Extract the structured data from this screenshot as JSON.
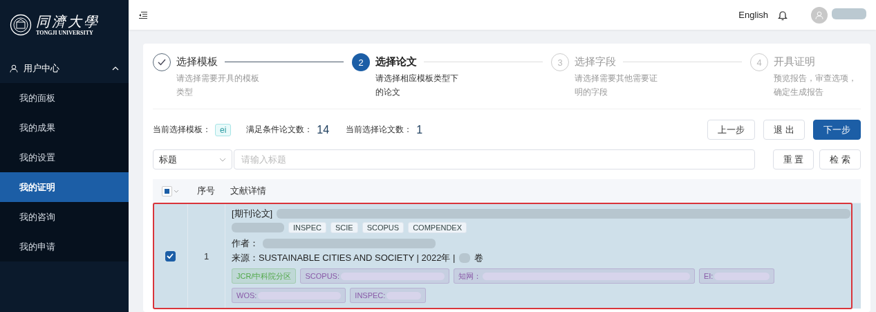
{
  "sidebar": {
    "logo": {
      "title": "同濟大學",
      "subtitle": "TONGJI UNIVERSITY"
    },
    "group": {
      "label": "用户中心",
      "expanded": true,
      "items": [
        {
          "label": "我的面板",
          "selected": false
        },
        {
          "label": "我的成果",
          "selected": false
        },
        {
          "label": "我的设置",
          "selected": false
        },
        {
          "label": "我的证明",
          "selected": true
        },
        {
          "label": "我的咨询",
          "selected": false
        },
        {
          "label": "我的申请",
          "selected": false
        }
      ]
    }
  },
  "header": {
    "language": "English"
  },
  "steps": [
    {
      "title": "选择模板",
      "description": "请选择需要开具的模板类型",
      "completed": true,
      "selected": false
    },
    {
      "number": "2",
      "title": "选择论文",
      "description": "请选择相应模板类型下的论文",
      "completed": false,
      "selected": true
    },
    {
      "number": "3",
      "title": "选择字段",
      "description": "请选择需要其他需要证明的字段",
      "completed": false,
      "selected": false
    },
    {
      "number": "4",
      "title": "开具证明",
      "description": "预览报告，审查选项，确定生成报告",
      "completed": false,
      "selected": false
    }
  ],
  "summary": {
    "template_label": "当前选择模板：",
    "template": "ei",
    "matching_label": "满足条件论文数：",
    "matching": "14",
    "selected_label": "当前选择论文数：",
    "selected": "1"
  },
  "actions": [
    {
      "label": "上一步",
      "kind": "plain"
    },
    {
      "label": "退 出",
      "kind": "plain"
    },
    {
      "label": "下一步",
      "kind": "primary"
    }
  ],
  "filter": {
    "field": "标题",
    "placeholder": "请输入标题",
    "buttons": [
      "重 置",
      "检 索"
    ]
  },
  "table": {
    "columns": [
      "序号",
      "文献详情"
    ],
    "header_indeterminate": true,
    "rows": [
      {
        "checked": true,
        "highlighted": true,
        "index": "1",
        "type_label": "[期刊论文]",
        "indexes": [
          "INSPEC",
          "SCIE",
          "SCOPUS",
          "COMPENDEX"
        ],
        "author_label": "作者：",
        "source": "来源：SUSTAINABLE CITIES AND SOCIETY | 2022年 |",
        "volume_suffix": "卷",
        "tags": [
          {
            "label": "JCR/中科院分区",
            "color": "#52a84a",
            "kind": "rank"
          },
          {
            "label": "SCOPUS:",
            "color": "#8a5aa8",
            "kind": "metric"
          },
          {
            "label": "知网：",
            "color": "#8a5aa8",
            "kind": "metric"
          },
          {
            "label": "EI:",
            "color": "#8a5aa8",
            "kind": "metric"
          },
          {
            "label": "WOS:",
            "color": "#8a5aa8",
            "kind": "metric"
          },
          {
            "label": "INSPEC:",
            "color": "#8a5aa8",
            "kind": "metric"
          }
        ]
      }
    ]
  }
}
